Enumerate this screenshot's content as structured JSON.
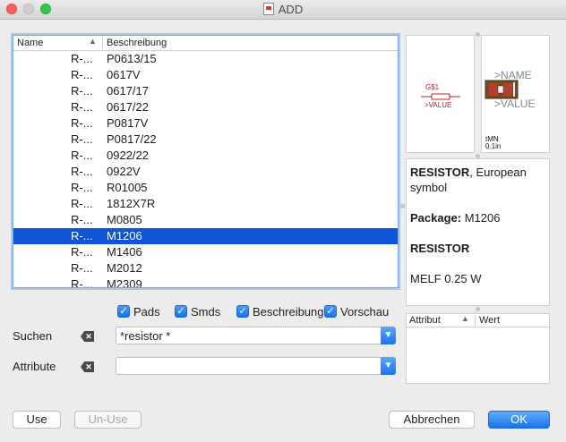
{
  "window": {
    "title": "ADD"
  },
  "list": {
    "columns": {
      "name": "Name",
      "description": "Beschreibung"
    },
    "rows": [
      {
        "name": "R-...",
        "description": "P0613/15"
      },
      {
        "name": "R-...",
        "description": "0617V"
      },
      {
        "name": "R-...",
        "description": "0617/17"
      },
      {
        "name": "R-...",
        "description": "0617/22"
      },
      {
        "name": "R-...",
        "description": "P0817V"
      },
      {
        "name": "R-...",
        "description": "P0817/22"
      },
      {
        "name": "R-...",
        "description": "0922/22"
      },
      {
        "name": "R-...",
        "description": "0922V"
      },
      {
        "name": "R-...",
        "description": "R01005"
      },
      {
        "name": "R-...",
        "description": "1812X7R"
      },
      {
        "name": "R-...",
        "description": "M0805"
      },
      {
        "name": "R-...",
        "description": "M1206",
        "selected": true
      },
      {
        "name": "R-...",
        "description": "M1406"
      },
      {
        "name": "R-...",
        "description": "M2012"
      },
      {
        "name": "R-...",
        "description": "M2309"
      }
    ]
  },
  "preview": {
    "symbol": {
      "name": "G$1",
      "value": ">VALUE"
    },
    "package": {
      "name": ">NAME",
      "value": ">VALUE",
      "tag": "tMN",
      "sub": "0.1in"
    }
  },
  "description": {
    "title": "RESISTOR",
    "title_suffix": ", European symbol",
    "package_label": "Package:",
    "package_value": "M1206",
    "heading": "RESISTOR",
    "detail": "MELF 0.25 W"
  },
  "attributes": {
    "col_attr": "Attribut",
    "col_value": "Wert"
  },
  "checkboxes": {
    "pads": "Pads",
    "smds": "Smds",
    "beschreibung": "Beschreibung",
    "vorschau": "Vorschau"
  },
  "search": {
    "label": "Suchen",
    "value": "*resistor *"
  },
  "attribute_filter": {
    "label": "Attribute",
    "value": ""
  },
  "buttons": {
    "use": "Use",
    "unuse": "Un-Use",
    "cancel": "Abbrechen",
    "ok": "OK"
  },
  "colors": {
    "accent": "#1a73eb",
    "selection": "#0f54d6"
  },
  "icons": {
    "clear": "clear-field-icon",
    "dropdown": "chevron-down-icon",
    "sort": "sort-ascending-icon"
  }
}
